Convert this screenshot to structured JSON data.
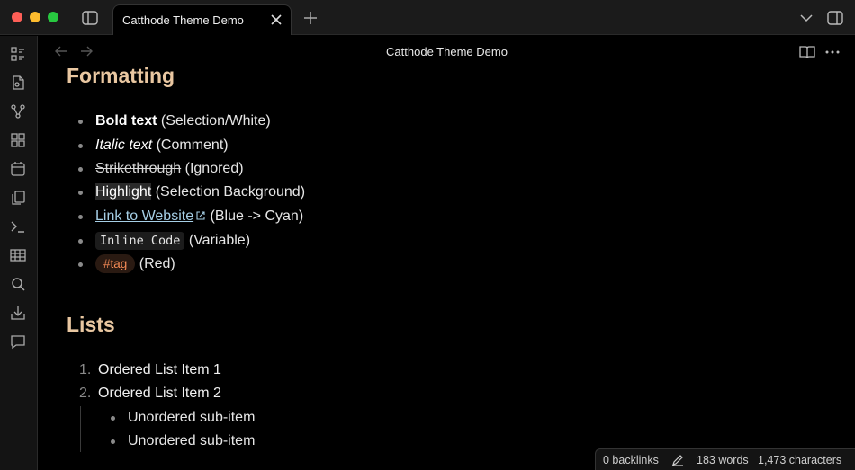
{
  "window": {
    "tab_title": "Catthode Theme Demo",
    "icons": [
      "sidebar-toggle-icon",
      "close-icon",
      "new-tab-icon",
      "chevron-down-icon",
      "right-sidebar-icon"
    ]
  },
  "ribbon": {
    "icons": [
      "file-explorer-icon",
      "open-file-icon",
      "graph-view-icon",
      "canvas-icon",
      "daily-note-icon",
      "templates-icon",
      "command-palette-icon",
      "table-icon",
      "search-icon",
      "import-icon",
      "chat-icon"
    ]
  },
  "header": {
    "title": "Catthode Theme Demo",
    "icons": [
      "back-arrow-icon",
      "forward-arrow-icon",
      "reading-view-icon",
      "more-options-icon"
    ]
  },
  "sections": {
    "formatting": {
      "heading": "Formatting",
      "items": {
        "bold": {
          "styled": "Bold text",
          "note": "(Selection/White)"
        },
        "italic": {
          "styled": "Italic text",
          "note": "(Comment)"
        },
        "strike": {
          "styled": "Strikethrough",
          "note": "(Ignored)"
        },
        "highlight": {
          "styled": "Highlight",
          "note": "(Selection Background)"
        },
        "link": {
          "styled": "Link to Website",
          "note": "(Blue -> Cyan)"
        },
        "code": {
          "styled": "Inline Code",
          "note": "(Variable)"
        },
        "tag": {
          "styled": "#tag",
          "note": "(Red)"
        }
      }
    },
    "lists": {
      "heading": "Lists",
      "ordered": [
        {
          "num": "1.",
          "text": "Ordered List Item 1"
        },
        {
          "num": "2.",
          "text": "Ordered List Item 2"
        }
      ],
      "sub": [
        "Unordered sub-item",
        "Unordered sub-item"
      ]
    }
  },
  "status": {
    "backlinks": "0 backlinks",
    "words": "183 words",
    "characters": "1,473 characters"
  },
  "colors": {
    "heading": "#e9c7a1",
    "link": "#a6cfe6",
    "tag": "#f48a55",
    "background": "#000000"
  }
}
